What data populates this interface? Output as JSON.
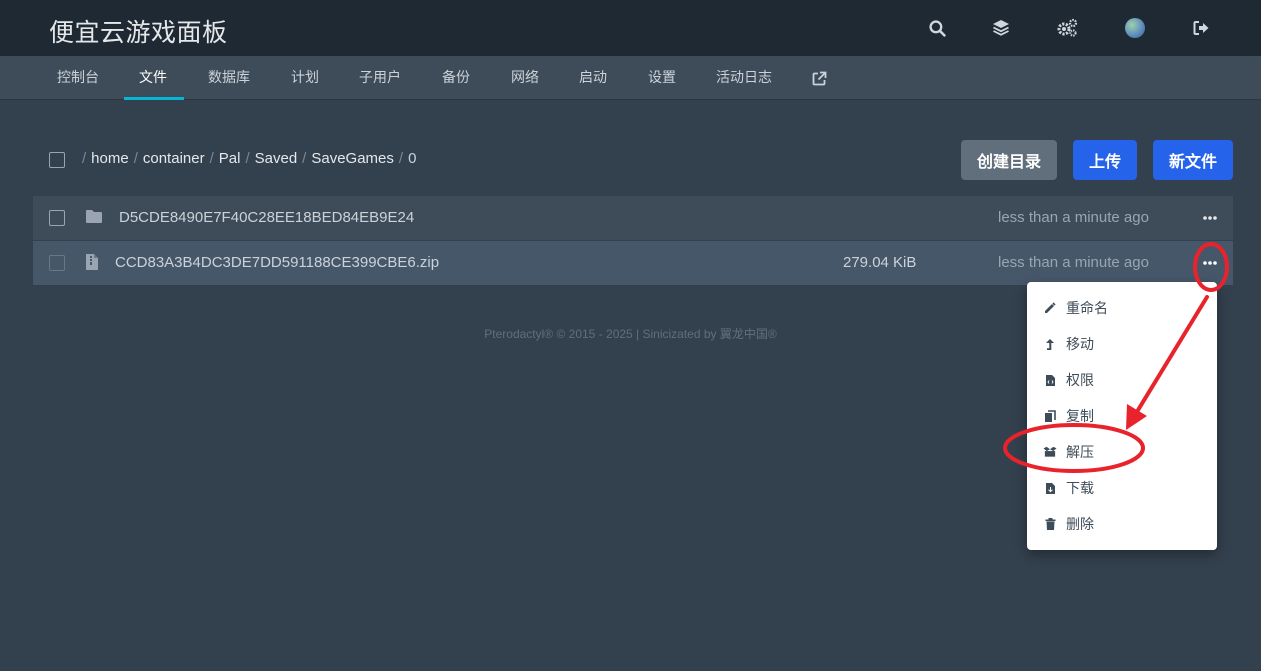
{
  "app": {
    "title": "便宜云游戏面板"
  },
  "topbar": {
    "icons": [
      "search-icon",
      "layers-icon",
      "cogs-icon",
      "avatar",
      "sign-out-icon"
    ]
  },
  "nav": {
    "tabs": [
      {
        "label": "控制台"
      },
      {
        "label": "文件",
        "active": true
      },
      {
        "label": "数据库"
      },
      {
        "label": "计划"
      },
      {
        "label": "子用户"
      },
      {
        "label": "备份"
      },
      {
        "label": "网络"
      },
      {
        "label": "启动"
      },
      {
        "label": "设置"
      },
      {
        "label": "活动日志"
      }
    ],
    "external_icon": "external-link-icon"
  },
  "breadcrumb": {
    "separator": "/",
    "segments": [
      "home",
      "container",
      "Pal",
      "Saved",
      "SaveGames",
      "0"
    ]
  },
  "actions": {
    "create_dir": "创建目录",
    "upload": "上传",
    "new_file": "新文件"
  },
  "files": [
    {
      "name": "D5CDE8490E7F40C28EE18BED84EB9E24",
      "type": "folder",
      "size": "",
      "modified": "less than a minute ago"
    },
    {
      "name": "CCD83A3B4DC3DE7DD591188CE399CBE6.zip",
      "type": "archive",
      "size": "279.04 KiB",
      "modified": "less than a minute ago"
    }
  ],
  "context_menu": {
    "items": [
      {
        "label": "重命名",
        "icon": "pencil-icon"
      },
      {
        "label": "移动",
        "icon": "level-up-icon"
      },
      {
        "label": "权限",
        "icon": "file-code-icon"
      },
      {
        "label": "复制",
        "icon": "copy-icon"
      },
      {
        "label": "解压",
        "icon": "box-open-icon"
      },
      {
        "label": "下载",
        "icon": "file-download-icon"
      },
      {
        "label": "删除",
        "icon": "trash-icon"
      }
    ]
  },
  "footer": {
    "text": "Pterodactyl® © 2015 - 2025 | Sinicizated by 翼龙中国®"
  },
  "colors": {
    "topbar": "#1f2933",
    "subnav": "#3e4c59",
    "background": "#33404d",
    "primary": "#2563eb",
    "secondary": "#616e7c",
    "tab_accent": "#06b6d4",
    "annotation": "#e8232b"
  }
}
